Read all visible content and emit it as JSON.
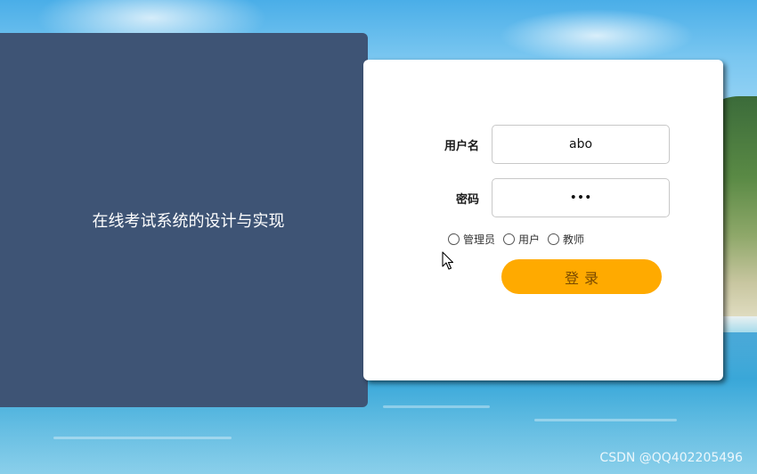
{
  "banner": {
    "title": "在线考试系统的设计与实现"
  },
  "login_form": {
    "username": {
      "label": "用户名",
      "value": "abo"
    },
    "password": {
      "label": "密码",
      "value": "•••"
    },
    "roles": [
      {
        "label": "管理员",
        "checked": false
      },
      {
        "label": "用户",
        "checked": false
      },
      {
        "label": "教师",
        "checked": false
      }
    ],
    "submit_label": "登录"
  },
  "watermark": "CSDN @QQ402205496",
  "colors": {
    "left_panel": "#3e5475",
    "login_button": "#ffaa00",
    "card_background": "#ffffff"
  }
}
